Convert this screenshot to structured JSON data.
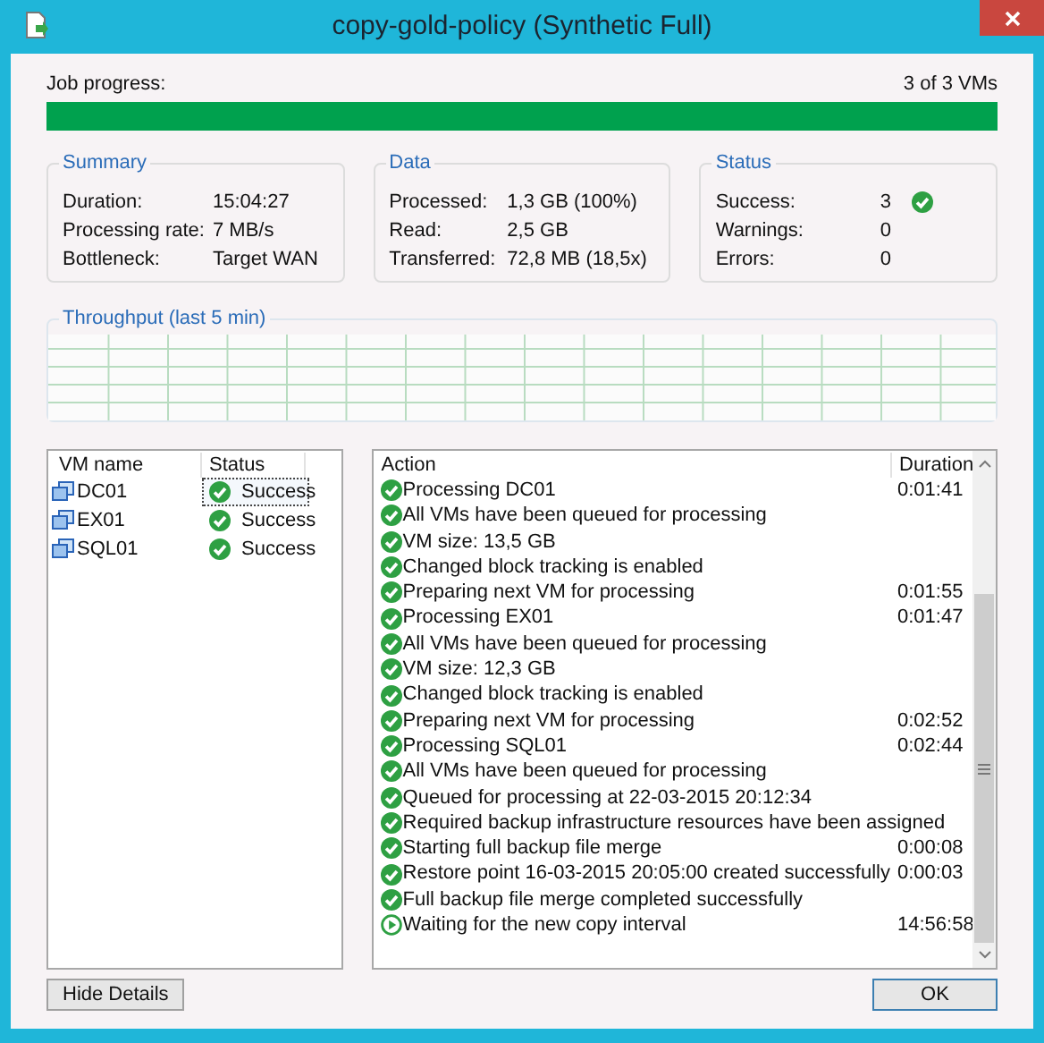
{
  "window": {
    "title": "copy-gold-policy (Synthetic Full)"
  },
  "job_progress": {
    "label": "Job progress:",
    "count": "3 of 3 VMs",
    "level": 1
  },
  "summary": {
    "title": "Summary",
    "rows": [
      {
        "label": "Duration:",
        "value": "15:04:27"
      },
      {
        "label": "Processing rate:",
        "value": "7 MB/s"
      },
      {
        "label": "Bottleneck:",
        "value": "Target WAN"
      }
    ]
  },
  "data": {
    "title": "Data",
    "rows": [
      {
        "label": "Processed:",
        "value": "1,3 GB (100%)"
      },
      {
        "label": "Read:",
        "value": "2,5 GB"
      },
      {
        "label": "Transferred:",
        "value": "72,8 MB (18,5x)"
      }
    ]
  },
  "status": {
    "title": "Status",
    "rows": [
      {
        "label": "Success:",
        "value": "3",
        "ok": true
      },
      {
        "label": "Warnings:",
        "value": "0",
        "ok": false
      },
      {
        "label": "Errors:",
        "value": "0",
        "ok": false
      }
    ]
  },
  "throughput": {
    "title": "Throughput (last 5 min)"
  },
  "vm_table": {
    "columns": [
      "VM name",
      "Status"
    ],
    "rows": [
      {
        "name": "DC01",
        "status": "Success",
        "selected": true
      },
      {
        "name": "EX01",
        "status": "Success",
        "selected": false
      },
      {
        "name": "SQL01",
        "status": "Success",
        "selected": false
      }
    ]
  },
  "action_table": {
    "columns": [
      "Action",
      "Duration"
    ],
    "rows": [
      {
        "kind": "success",
        "action": "Processing DC01",
        "duration": "0:01:41"
      },
      {
        "kind": "success",
        "action": "All VMs have been queued for processing"
      },
      {
        "kind": "success",
        "action": "VM size: 13,5 GB"
      },
      {
        "kind": "success",
        "action": "Changed block tracking is enabled"
      },
      {
        "kind": "success",
        "action": "Preparing next VM for processing",
        "duration": "0:01:55"
      },
      {
        "kind": "success",
        "action": "Processing EX01",
        "duration": "0:01:47"
      },
      {
        "kind": "success",
        "action": "All VMs have been queued for processing"
      },
      {
        "kind": "success",
        "action": "VM size: 12,3 GB"
      },
      {
        "kind": "success",
        "action": "Changed block tracking is enabled"
      },
      {
        "kind": "success",
        "action": "Preparing next VM for processing",
        "duration": "0:02:52"
      },
      {
        "kind": "success",
        "action": "Processing SQL01",
        "duration": "0:02:44"
      },
      {
        "kind": "success",
        "action": "All VMs have been queued for processing"
      },
      {
        "kind": "success",
        "action": "Queued for processing at 22-03-2015 20:12:34"
      },
      {
        "kind": "success",
        "action": "Required backup infrastructure resources have been assigned"
      },
      {
        "kind": "success",
        "action": "Starting full backup file merge",
        "duration": "0:00:08"
      },
      {
        "kind": "success",
        "action": "Restore point 16-03-2015 20:05:00 created successfully",
        "duration": "0:00:03"
      },
      {
        "kind": "success",
        "action": "Full backup file merge completed successfully"
      },
      {
        "kind": "running",
        "action": "Waiting for the new copy interval",
        "duration": "14:56:58"
      }
    ]
  },
  "buttons": {
    "hide_details": "Hide Details",
    "ok": "OK"
  }
}
